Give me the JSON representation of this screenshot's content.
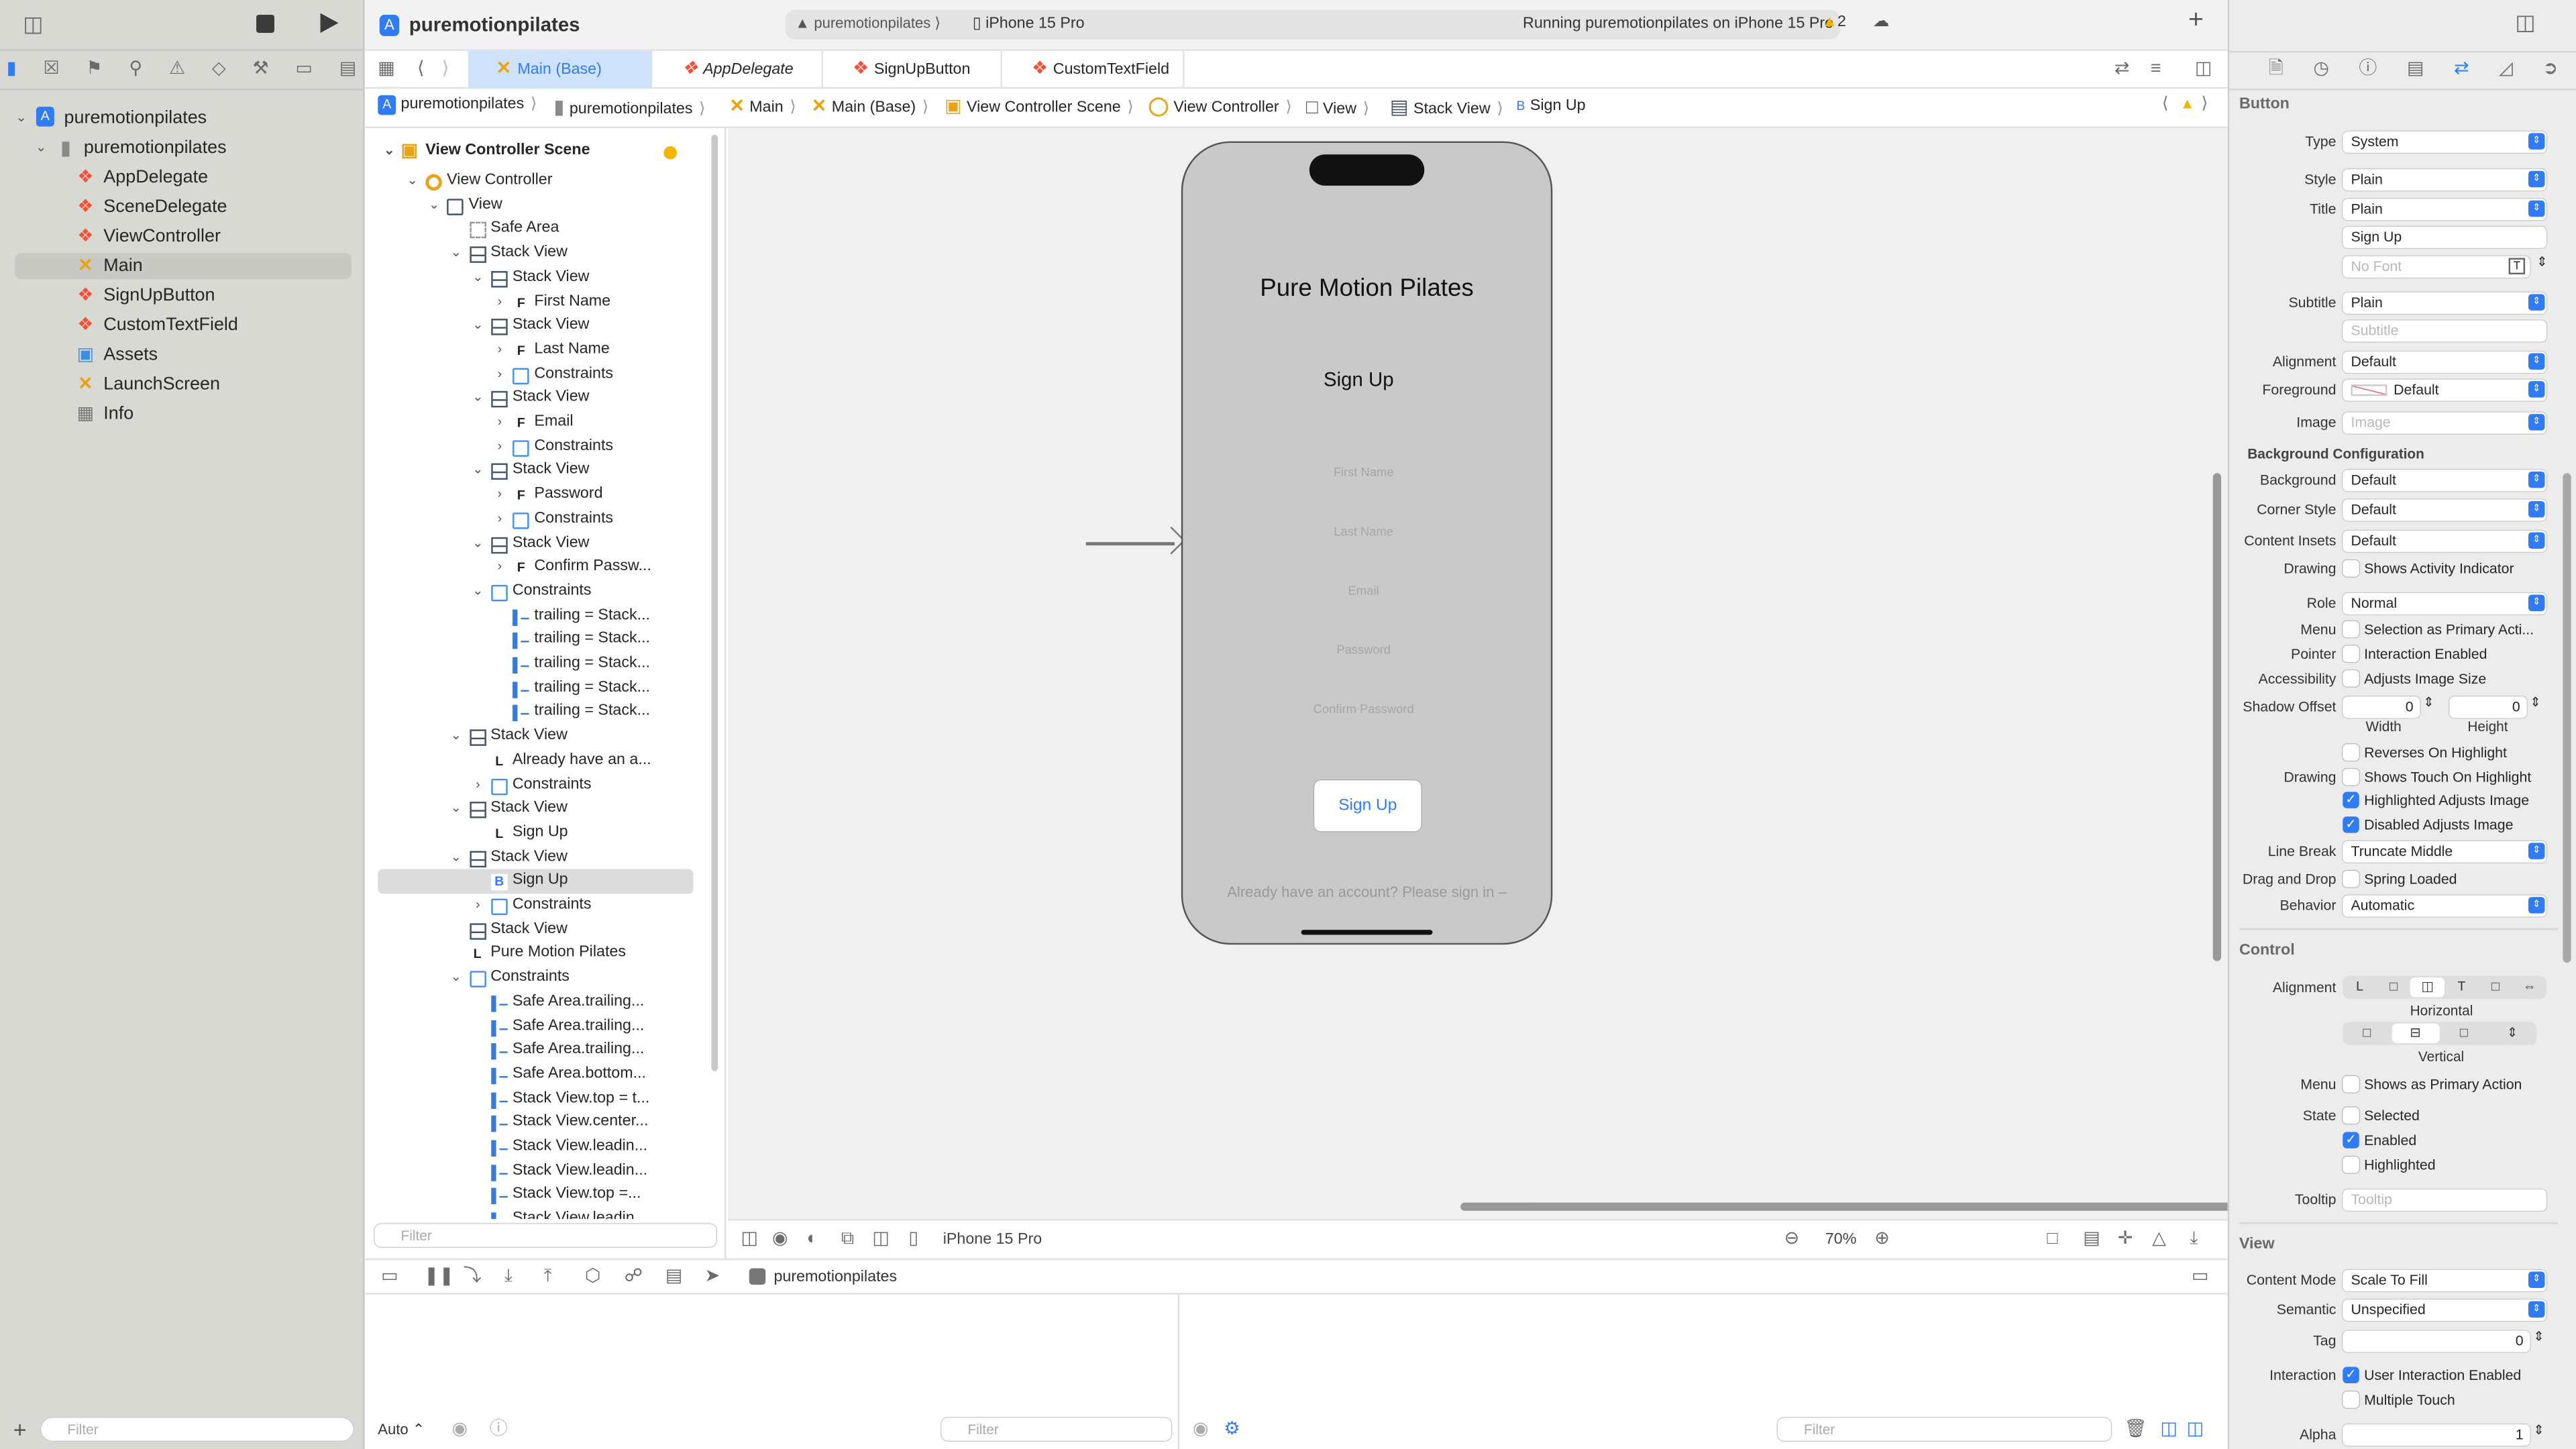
{
  "toolbar": {
    "project_name": "puremotionpilates",
    "scheme": "puremotionpilates",
    "device": "iPhone 15 Pro",
    "status": "Running puremotionpilates on iPhone 15 Pro",
    "warning_count": "2",
    "icons": [
      "sidebar-toggle-icon",
      "stop-icon",
      "run-icon",
      "add-icon",
      "inspector-toggle-icon"
    ]
  },
  "navigator": {
    "icons": [
      "folder-icon",
      "source-control-icon",
      "bookmark-icon",
      "find-icon",
      "issue-icon",
      "test-icon",
      "debug-icon",
      "breakpoint-icon",
      "report-icon"
    ],
    "items": [
      {
        "label": "puremotionpilates",
        "icon": "project",
        "level": 0,
        "expanded": true
      },
      {
        "label": "puremotionpilates",
        "icon": "folder",
        "level": 1,
        "expanded": true
      },
      {
        "label": "AppDelegate",
        "icon": "swift",
        "level": 2
      },
      {
        "label": "SceneDelegate",
        "icon": "swift",
        "level": 2
      },
      {
        "label": "ViewController",
        "icon": "swift",
        "level": 2
      },
      {
        "label": "Main",
        "icon": "storyboard",
        "level": 2,
        "selected": true
      },
      {
        "label": "SignUpButton",
        "icon": "swift",
        "level": 2
      },
      {
        "label": "CustomTextField",
        "icon": "swift",
        "level": 2
      },
      {
        "label": "Assets",
        "icon": "assets",
        "level": 2
      },
      {
        "label": "LaunchScreen",
        "icon": "storyboard",
        "level": 2
      },
      {
        "label": "Info",
        "icon": "plist",
        "level": 2
      }
    ],
    "filter_placeholder": "Filter"
  },
  "tabs": [
    {
      "label": "Main (Base)",
      "icon": "storyboard",
      "active": true
    },
    {
      "label": "AppDelegate",
      "icon": "swift",
      "italic": true
    },
    {
      "label": "SignUpButton",
      "icon": "swift"
    },
    {
      "label": "CustomTextField",
      "icon": "swift"
    }
  ],
  "breadcrumb": [
    {
      "label": "puremotionpilates",
      "icon": "project"
    },
    {
      "label": "puremotionpilates",
      "icon": "folder"
    },
    {
      "label": "Main",
      "icon": "storyboard"
    },
    {
      "label": "Main (Base)",
      "icon": "storyboard"
    },
    {
      "label": "View Controller Scene",
      "icon": "scene"
    },
    {
      "label": "View Controller",
      "icon": "vc"
    },
    {
      "label": "View",
      "icon": "view"
    },
    {
      "label": "Stack View",
      "icon": "stack"
    },
    {
      "label": "Sign Up",
      "icon": "B"
    }
  ],
  "outline": {
    "scene": "View Controller Scene",
    "rows": [
      {
        "label": "View Controller",
        "icon": "vc",
        "level": 1,
        "chev": "open"
      },
      {
        "label": "View",
        "icon": "view",
        "level": 2,
        "chev": "open"
      },
      {
        "label": "Safe Area",
        "icon": "safe",
        "level": 3
      },
      {
        "label": "Stack View",
        "icon": "stack",
        "level": 3,
        "chev": "open"
      },
      {
        "label": "Stack View",
        "icon": "stack",
        "level": 4,
        "chev": "open"
      },
      {
        "label": "First Name",
        "icon": "F",
        "level": 5,
        "chev": "closed"
      },
      {
        "label": "Stack View",
        "icon": "stack",
        "level": 4,
        "chev": "open"
      },
      {
        "label": "Last Name",
        "icon": "F",
        "level": 5,
        "chev": "closed"
      },
      {
        "label": "Constraints",
        "icon": "cons",
        "level": 5,
        "chev": "closed"
      },
      {
        "label": "Stack View",
        "icon": "stack",
        "level": 4,
        "chev": "open"
      },
      {
        "label": "Email",
        "icon": "F",
        "level": 5,
        "chev": "closed"
      },
      {
        "label": "Constraints",
        "icon": "cons",
        "level": 5,
        "chev": "closed"
      },
      {
        "label": "Stack View",
        "icon": "stack",
        "level": 4,
        "chev": "open"
      },
      {
        "label": "Password",
        "icon": "F",
        "level": 5,
        "chev": "closed"
      },
      {
        "label": "Constraints",
        "icon": "cons",
        "level": 5,
        "chev": "closed"
      },
      {
        "label": "Stack View",
        "icon": "stack",
        "level": 4,
        "chev": "open"
      },
      {
        "label": "Confirm Passw...",
        "icon": "F",
        "level": 5,
        "chev": "closed"
      },
      {
        "label": "Constraints",
        "icon": "cons",
        "level": 4,
        "chev": "open"
      },
      {
        "label": "trailing = Stack...",
        "icon": "c",
        "level": 5
      },
      {
        "label": "trailing = Stack...",
        "icon": "c",
        "level": 5
      },
      {
        "label": "trailing = Stack...",
        "icon": "c",
        "level": 5
      },
      {
        "label": "trailing = Stack...",
        "icon": "c",
        "level": 5
      },
      {
        "label": "trailing = Stack...",
        "icon": "c",
        "level": 5
      },
      {
        "label": "Stack View",
        "icon": "stack",
        "level": 3,
        "chev": "open"
      },
      {
        "label": "Already have an a...",
        "icon": "L",
        "level": 4
      },
      {
        "label": "Constraints",
        "icon": "cons",
        "level": 4,
        "chev": "closed"
      },
      {
        "label": "Stack View",
        "icon": "stack",
        "level": 3,
        "chev": "open"
      },
      {
        "label": "Sign Up",
        "icon": "L",
        "level": 4
      },
      {
        "label": "Stack View",
        "icon": "stack",
        "level": 3,
        "chev": "open"
      },
      {
        "label": "Sign Up",
        "icon": "B",
        "level": 4,
        "selected": true
      },
      {
        "label": "Constraints",
        "icon": "cons",
        "level": 4,
        "chev": "closed"
      },
      {
        "label": "Stack View",
        "icon": "stack",
        "level": 3
      },
      {
        "label": "Pure Motion Pilates",
        "icon": "L",
        "level": 3
      },
      {
        "label": "Constraints",
        "icon": "cons",
        "level": 3,
        "chev": "open"
      },
      {
        "label": "Safe Area.trailing...",
        "icon": "c",
        "level": 4
      },
      {
        "label": "Safe Area.trailing...",
        "icon": "c",
        "level": 4
      },
      {
        "label": "Safe Area.trailing...",
        "icon": "c",
        "level": 4
      },
      {
        "label": "Safe Area.bottom...",
        "icon": "c",
        "level": 4
      },
      {
        "label": "Stack View.top = t...",
        "icon": "c",
        "level": 4
      },
      {
        "label": "Stack View.center...",
        "icon": "c",
        "level": 4
      },
      {
        "label": "Stack View.leadin...",
        "icon": "c",
        "level": 4
      },
      {
        "label": "Stack View.leadin...",
        "icon": "c",
        "level": 4
      },
      {
        "label": "Stack View.top =...",
        "icon": "c",
        "level": 4
      },
      {
        "label": "Stack View.leadin...",
        "icon": "c",
        "level": 4
      }
    ],
    "filter_placeholder": "Filter"
  },
  "canvas": {
    "app_title": "Pure Motion Pilates",
    "signup_label": "Sign Up",
    "fields": [
      "First Name",
      "Last Name",
      "Email",
      "Password",
      "Confirm Password"
    ],
    "button_label": "Sign Up",
    "signin_text": "Already have an account? Please sign in –",
    "device": "iPhone 15 Pro",
    "zoom": "70%"
  },
  "debug": {
    "process": "puremotionpilates",
    "output_mode": "Auto ⌃",
    "filter_placeholder": "Filter"
  },
  "inspector": {
    "accent": "#2f7cf6",
    "rows": [
      {
        "kind": "section",
        "label": "Button"
      },
      {
        "kind": "popup",
        "label": "Type",
        "value": "System"
      },
      {
        "kind": "popup",
        "label": "Style",
        "value": "Plain"
      },
      {
        "kind": "popup",
        "label": "Title",
        "value": "Plain"
      },
      {
        "kind": "text",
        "label": "",
        "value": "Sign Up"
      },
      {
        "kind": "font",
        "label": "",
        "placeholder": "No Font"
      },
      {
        "kind": "popup",
        "label": "Subtitle",
        "value": "Plain"
      },
      {
        "kind": "placeholder",
        "label": "",
        "placeholder": "Subtitle"
      },
      {
        "kind": "popup",
        "label": "Alignment",
        "value": "Default"
      },
      {
        "kind": "color",
        "label": "Foreground",
        "value": "Default"
      },
      {
        "kind": "popup",
        "label": "Image",
        "placeholder": "Image"
      },
      {
        "kind": "subsection",
        "label": "Background Configuration"
      },
      {
        "kind": "popup",
        "label": "Background",
        "value": "Default"
      },
      {
        "kind": "popup",
        "label": "Corner Style",
        "value": "Default"
      },
      {
        "kind": "popup",
        "label": "Content Insets",
        "value": "Default"
      },
      {
        "kind": "check",
        "label": "Drawing",
        "value": "Shows Activity Indicator",
        "checked": false
      },
      {
        "kind": "popup",
        "label": "Role",
        "value": "Normal"
      },
      {
        "kind": "check",
        "label": "Menu",
        "value": "Selection as Primary Acti...",
        "checked": false
      },
      {
        "kind": "check",
        "label": "Pointer",
        "value": "Interaction Enabled",
        "checked": false
      },
      {
        "kind": "check",
        "label": "Accessibility",
        "value": "Adjusts Image Size",
        "checked": false
      },
      {
        "kind": "stepper2",
        "label": "Shadow Offset",
        "value": "0",
        "value2": "0",
        "caption": "Width",
        "caption2": "Height"
      },
      {
        "kind": "check",
        "label": "",
        "value": "Reverses On Highlight",
        "checked": false
      },
      {
        "kind": "check",
        "label": "Drawing",
        "value": "Shows Touch On Highlight",
        "checked": false
      },
      {
        "kind": "check",
        "label": "",
        "value": "Highlighted Adjusts Image",
        "checked": true
      },
      {
        "kind": "check",
        "label": "",
        "value": "Disabled Adjusts Image",
        "checked": true
      },
      {
        "kind": "popup",
        "label": "Line Break",
        "value": "Truncate Middle"
      },
      {
        "kind": "check",
        "label": "Drag and Drop",
        "value": "Spring Loaded",
        "checked": false
      },
      {
        "kind": "popup",
        "label": "Behavior",
        "value": "Automatic"
      },
      {
        "kind": "section",
        "label": "Control"
      },
      {
        "kind": "seg",
        "label": "Alignment",
        "segments": [
          "L",
          "□",
          "◫",
          "T",
          "□",
          "⇔"
        ],
        "selected": 2,
        "caption": "Horizontal"
      },
      {
        "kind": "seg",
        "label": "",
        "segments": [
          "□",
          "⊟",
          "□",
          "⇕"
        ],
        "selected": 1,
        "caption": "Vertical"
      },
      {
        "kind": "check",
        "label": "Menu",
        "value": "Shows as Primary Action",
        "checked": false
      },
      {
        "kind": "check",
        "label": "State",
        "value": "Selected",
        "checked": false
      },
      {
        "kind": "check",
        "label": "",
        "value": "Enabled",
        "checked": true
      },
      {
        "kind": "check",
        "label": "",
        "value": "Highlighted",
        "checked": false
      },
      {
        "kind": "placeholder",
        "label": "Tooltip",
        "placeholder": "Tooltip"
      },
      {
        "kind": "section",
        "label": "View"
      },
      {
        "kind": "popup",
        "label": "Content Mode",
        "value": "Scale To Fill"
      },
      {
        "kind": "popup",
        "label": "Semantic",
        "value": "Unspecified"
      },
      {
        "kind": "stepper",
        "label": "Tag",
        "value": "0"
      },
      {
        "kind": "check",
        "label": "Interaction",
        "value": "User Interaction Enabled",
        "checked": true
      },
      {
        "kind": "check",
        "label": "",
        "value": "Multiple Touch",
        "checked": false
      },
      {
        "kind": "stepper",
        "label": "Alpha",
        "value": "1"
      }
    ]
  }
}
